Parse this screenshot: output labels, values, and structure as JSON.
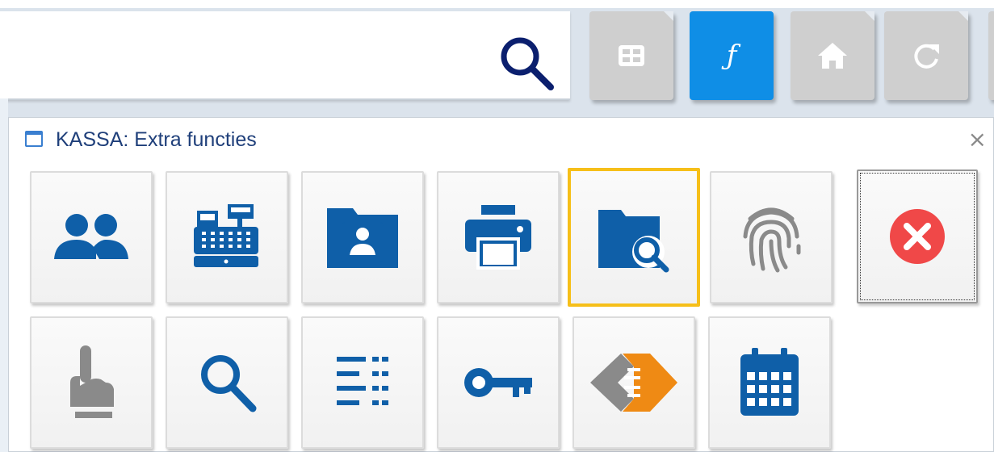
{
  "toolbar": {
    "search_value": "",
    "buttons": [
      {
        "name": "grid-view",
        "icon": "grid-icon",
        "active": false
      },
      {
        "name": "functions",
        "icon": "function-icon",
        "label": "ƒ",
        "active": true
      },
      {
        "name": "home",
        "icon": "home-icon",
        "active": false
      },
      {
        "name": "refresh",
        "icon": "refresh-icon",
        "active": false
      }
    ]
  },
  "dialog": {
    "title": "KASSA: Extra functies",
    "close_glyph": "×",
    "row1": [
      {
        "icon": "users-icon"
      },
      {
        "icon": "cash-register-icon"
      },
      {
        "icon": "contact-folder-icon"
      },
      {
        "icon": "printer-icon"
      },
      {
        "icon": "folder-search-icon",
        "selected": true
      },
      {
        "icon": "fingerprint-icon"
      },
      {
        "icon": "close-circle-icon"
      }
    ],
    "row2": [
      {
        "icon": "hand-pointer-icon"
      },
      {
        "icon": "search-icon"
      },
      {
        "icon": "list-icon"
      },
      {
        "icon": "key-icon"
      },
      {
        "icon": "diamond-arrows-icon"
      },
      {
        "icon": "calendar-icon"
      }
    ]
  },
  "colors": {
    "accent_blue": "#0f5fa8",
    "active_button": "#0f8ee6",
    "selection_border": "#f6bf19",
    "close_red": "#f04848",
    "orange": "#ef8a14",
    "grey_icon": "#8a8a8a"
  }
}
